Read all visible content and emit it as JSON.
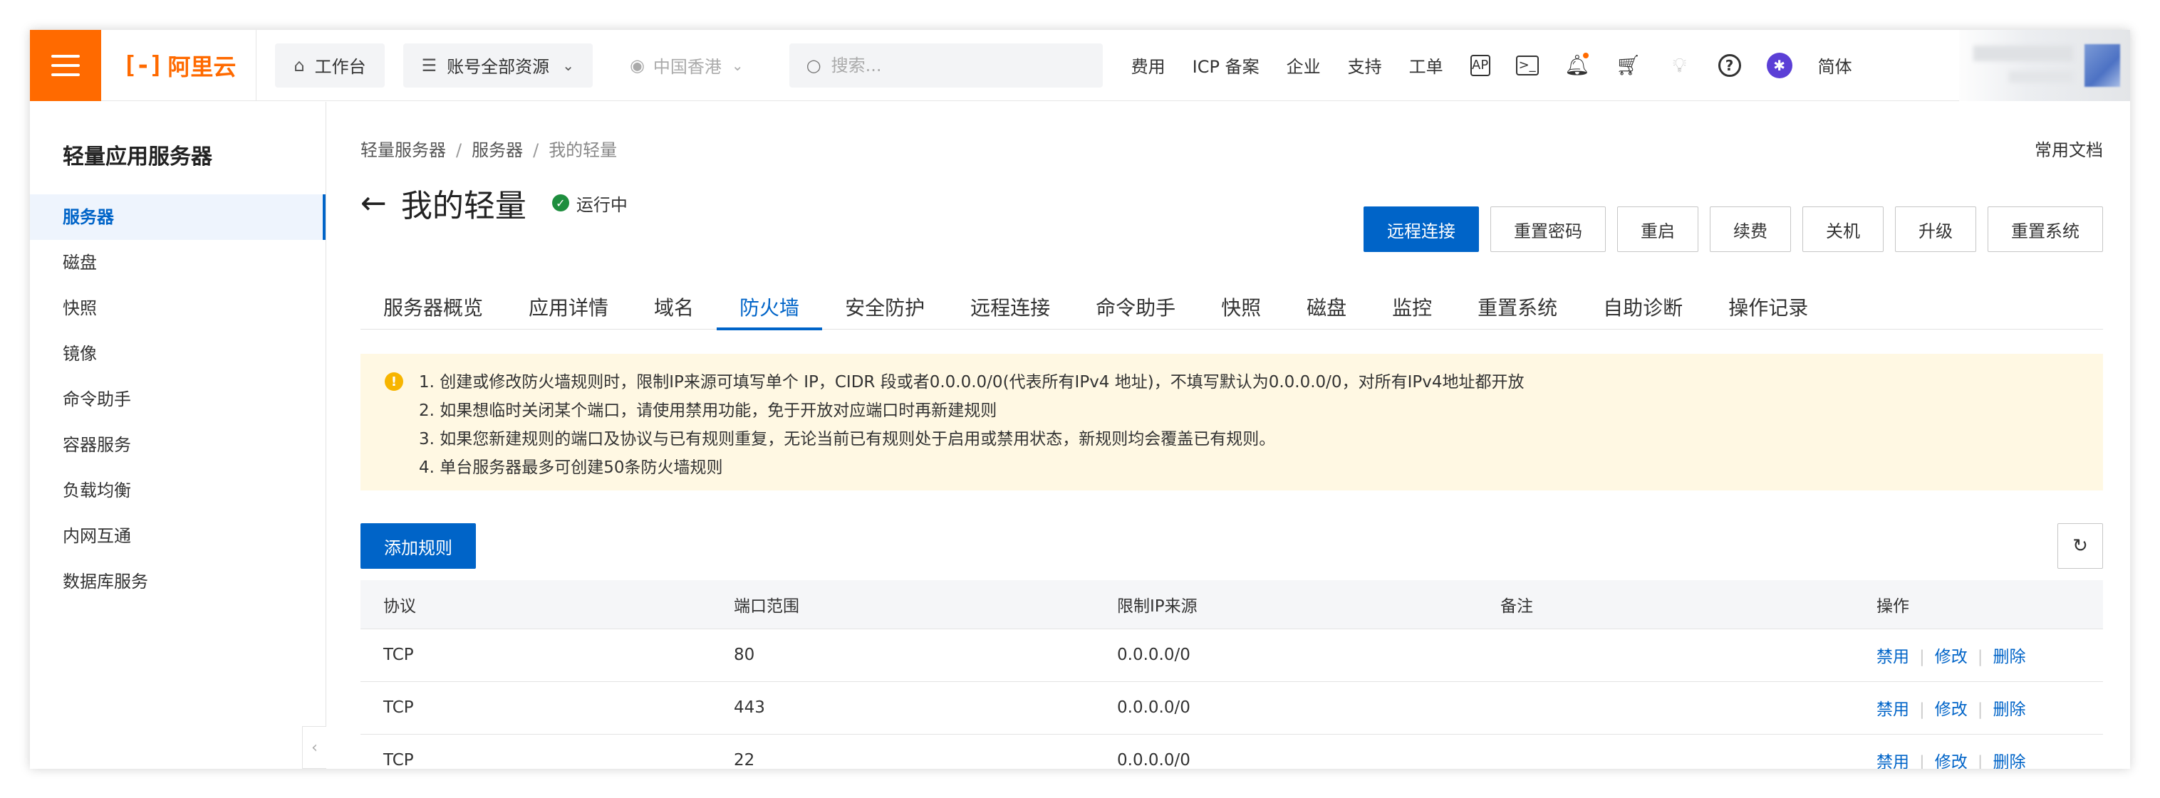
{
  "topbar": {
    "logo_text": "阿里云",
    "logo_mark": "[-]",
    "workbench": "工作台",
    "resources": "账号全部资源",
    "region": "中国香港",
    "search_placeholder": "搜索...",
    "links": [
      "费用",
      "ICP 备案",
      "企业",
      "支持",
      "工单"
    ],
    "lang": "简体",
    "accent": "#ff6a00"
  },
  "sidebar": {
    "title": "轻量应用服务器",
    "items": [
      "服务器",
      "磁盘",
      "快照",
      "镜像",
      "命令助手",
      "容器服务",
      "负载均衡",
      "内网互通",
      "数据库服务"
    ],
    "active_index": 0
  },
  "main": {
    "breadcrumb": [
      "轻量服务器",
      "服务器",
      "我的轻量"
    ],
    "docs_link": "常用文档",
    "title": "我的轻量",
    "status": "运行中",
    "status_color": "#1e8e3e",
    "actions": [
      "远程连接",
      "重置密码",
      "重启",
      "续费",
      "关机",
      "升级",
      "重置系统"
    ],
    "tabs": [
      "服务器概览",
      "应用详情",
      "域名",
      "防火墙",
      "安全防护",
      "远程连接",
      "命令助手",
      "快照",
      "磁盘",
      "监控",
      "重置系统",
      "自助诊断",
      "操作记录"
    ],
    "active_tab": 3,
    "notice": [
      "1. 创建或修改防火墙规则时，限制IP来源可填写单个 IP，CIDR 段或者0.0.0.0/0(代表所有IPv4 地址)，不填写默认为0.0.0.0/0，对所有IPv4地址都开放",
      "2. 如果想临时关闭某个端口，请使用禁用功能，免于开放对应端口时再新建规则",
      "3. 如果您新建规则的端口及协议与已有规则重复，无论当前已有规则处于启用或禁用状态，新规则均会覆盖已有规则。",
      "4. 单台服务器最多可创建50条防火墙规则"
    ],
    "add_rule": "添加规则",
    "primary_color": "#0064c8"
  },
  "table": {
    "headers": [
      "协议",
      "端口范围",
      "限制IP来源",
      "备注",
      "操作"
    ],
    "rows": [
      {
        "protocol": "TCP",
        "port": "80",
        "source": "0.0.0.0/0",
        "note": ""
      },
      {
        "protocol": "TCP",
        "port": "443",
        "source": "0.0.0.0/0",
        "note": ""
      },
      {
        "protocol": "TCP",
        "port": "22",
        "source": "0.0.0.0/0",
        "note": ""
      }
    ],
    "ops": [
      "禁用",
      "修改",
      "删除"
    ]
  }
}
